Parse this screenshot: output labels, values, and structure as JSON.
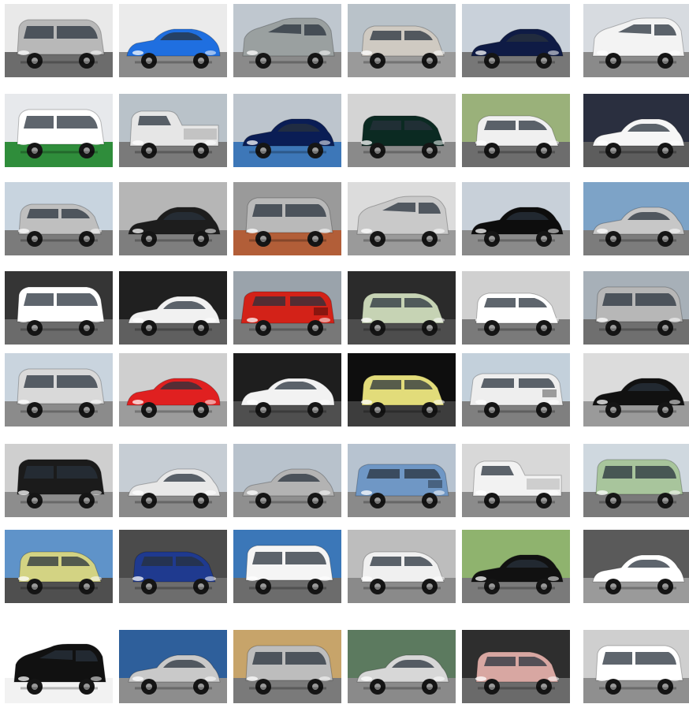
{
  "grid": {
    "tiles": [
      {
        "color": "#b8b8b8",
        "bg": "#e9e9e9",
        "ground": "#6c6c6c",
        "type": "van"
      },
      {
        "color": "#1f6fe0",
        "bg": "#ebebeb",
        "ground": "#8b8b8b",
        "type": "sport"
      },
      {
        "color": "#9aa0a0",
        "bg": "#bfc7cf",
        "ground": "#8a8a8a",
        "type": "suv"
      },
      {
        "color": "#cfcac2",
        "bg": "#b9c2c9",
        "ground": "#9a9a9a",
        "type": "compact"
      },
      {
        "color": "#0f1b45",
        "bg": "#c9d1da",
        "ground": "#777777",
        "type": "sedan"
      },
      {
        "color": "#f3f3f3",
        "bg": "#d7dbe0",
        "ground": "#8a8a8a",
        "type": "suv"
      },
      {
        "color": "#ffffff",
        "bg": "#e7e9ec",
        "ground": "#2f8d3b",
        "type": "van"
      },
      {
        "color": "#e6e6e6",
        "bg": "#b9c2c9",
        "ground": "#7a7a7a",
        "type": "truck"
      },
      {
        "color": "#0a1d55",
        "bg": "#bdc5cd",
        "ground": "#3d77b8",
        "type": "sedan"
      },
      {
        "color": "#0b2a22",
        "bg": "#d4d4d4",
        "ground": "#8a8a8a",
        "type": "compact"
      },
      {
        "color": "#f0f0f0",
        "bg": "#9ab17a",
        "ground": "#6d6d6d",
        "type": "compact"
      },
      {
        "color": "#f6f6f6",
        "bg": "#2a2f3f",
        "ground": "#5d5d5d",
        "type": "sedan"
      },
      {
        "color": "#bfbfbf",
        "bg": "#c8d4df",
        "ground": "#7b7b7b",
        "type": "compact"
      },
      {
        "color": "#1d1d1d",
        "bg": "#b6b6b6",
        "ground": "#7e7e7e",
        "type": "sedan"
      },
      {
        "color": "#b9b9b9",
        "bg": "#9a9a9a",
        "ground": "#b25e38",
        "type": "van"
      },
      {
        "color": "#c9c9c9",
        "bg": "#dcdcdc",
        "ground": "#9a9a9a",
        "type": "suv"
      },
      {
        "color": "#0d0d0d",
        "bg": "#c8d0d9",
        "ground": "#8a8a8a",
        "type": "sedan"
      },
      {
        "color": "#c7c7c7",
        "bg": "#7da3c7",
        "ground": "#7c7c7c",
        "type": "sedan"
      },
      {
        "color": "#ffffff",
        "bg": "#353535",
        "ground": "#6b6b6b",
        "type": "van"
      },
      {
        "color": "#f1f1f1",
        "bg": "#202020",
        "ground": "#5f5f5f",
        "type": "sedan"
      },
      {
        "color": "#d32218",
        "bg": "#9aa3ab",
        "ground": "#787878",
        "type": "jeep"
      },
      {
        "color": "#c6d3b4",
        "bg": "#2b2b2b",
        "ground": "#4d4d4d",
        "type": "compact"
      },
      {
        "color": "#ffffff",
        "bg": "#d0d0d0",
        "ground": "#7a7a7a",
        "type": "compact"
      },
      {
        "color": "#b7b7b7",
        "bg": "#a7b0b8",
        "ground": "#6f6f6f",
        "type": "van"
      },
      {
        "color": "#d9d9d9",
        "bg": "#c9d4de",
        "ground": "#8b8b8b",
        "type": "van"
      },
      {
        "color": "#e02020",
        "bg": "#cfcfcf",
        "ground": "#9c9c9c",
        "type": "sport"
      },
      {
        "color": "#f2f2f2",
        "bg": "#1e1e1e",
        "ground": "#4f4f4f",
        "type": "sport"
      },
      {
        "color": "#e2dc7a",
        "bg": "#0e0e0e",
        "ground": "#3d3d3d",
        "type": "compact"
      },
      {
        "color": "#eeeeee",
        "bg": "#c3d0db",
        "ground": "#7f7f7f",
        "type": "jeep"
      },
      {
        "color": "#111111",
        "bg": "#dcdcdc",
        "ground": "#9a9a9a",
        "type": "sedan"
      },
      {
        "color": "#1b1b1b",
        "bg": "#cfcfcf",
        "ground": "#8d8d8d",
        "type": "van"
      },
      {
        "color": "#e8e8e8",
        "bg": "#c6cdd4",
        "ground": "#8a8a8a",
        "type": "sedan"
      },
      {
        "color": "#b3b3b3",
        "bg": "#b8c2cc",
        "ground": "#8f8f8f",
        "type": "sedan"
      },
      {
        "color": "#6f97c5",
        "bg": "#b7c3d0",
        "ground": "#8a8a8a",
        "type": "jeep"
      },
      {
        "color": "#f2f2f2",
        "bg": "#d8d8d8",
        "ground": "#8b8b8b",
        "type": "truck"
      },
      {
        "color": "#a8c59c",
        "bg": "#cfd8df",
        "ground": "#7a7a7a",
        "type": "van"
      },
      {
        "color": "#d3d383",
        "bg": "#5f93c9",
        "ground": "#4f4f4f",
        "type": "compact"
      },
      {
        "color": "#1f3a8f",
        "bg": "#4b4b4b",
        "ground": "#6d6d6d",
        "type": "compact"
      },
      {
        "color": "#f5f5f5",
        "bg": "#3b77b8",
        "ground": "#6c6c6c",
        "type": "van"
      },
      {
        "color": "#f0f0f0",
        "bg": "#bdbdbd",
        "ground": "#8a8a8a",
        "type": "compact"
      },
      {
        "color": "#111111",
        "bg": "#8fb36e",
        "ground": "#7a7a7a",
        "type": "sedan"
      },
      {
        "color": "#ffffff",
        "bg": "#5a5a5a",
        "ground": "#9a9a9a",
        "type": "sedan"
      },
      {
        "color": "#111111",
        "bg": "#ffffff",
        "ground": "#f2f2f2",
        "type": "suv"
      },
      {
        "color": "#c9c9c9",
        "bg": "#2e5f9b",
        "ground": "#8d8d8d",
        "type": "sedan"
      },
      {
        "color": "#bdbdbd",
        "bg": "#c7a46a",
        "ground": "#7a7a7a",
        "type": "van"
      },
      {
        "color": "#d7d7d7",
        "bg": "#5c7a5f",
        "ground": "#8a8a8a",
        "type": "sedan"
      },
      {
        "color": "#d8a7a2",
        "bg": "#2e2e2e",
        "ground": "#6a6a6a",
        "type": "compact"
      },
      {
        "color": "#ffffff",
        "bg": "#cfcfcf",
        "ground": "#8f8f8f",
        "type": "van"
      }
    ]
  }
}
